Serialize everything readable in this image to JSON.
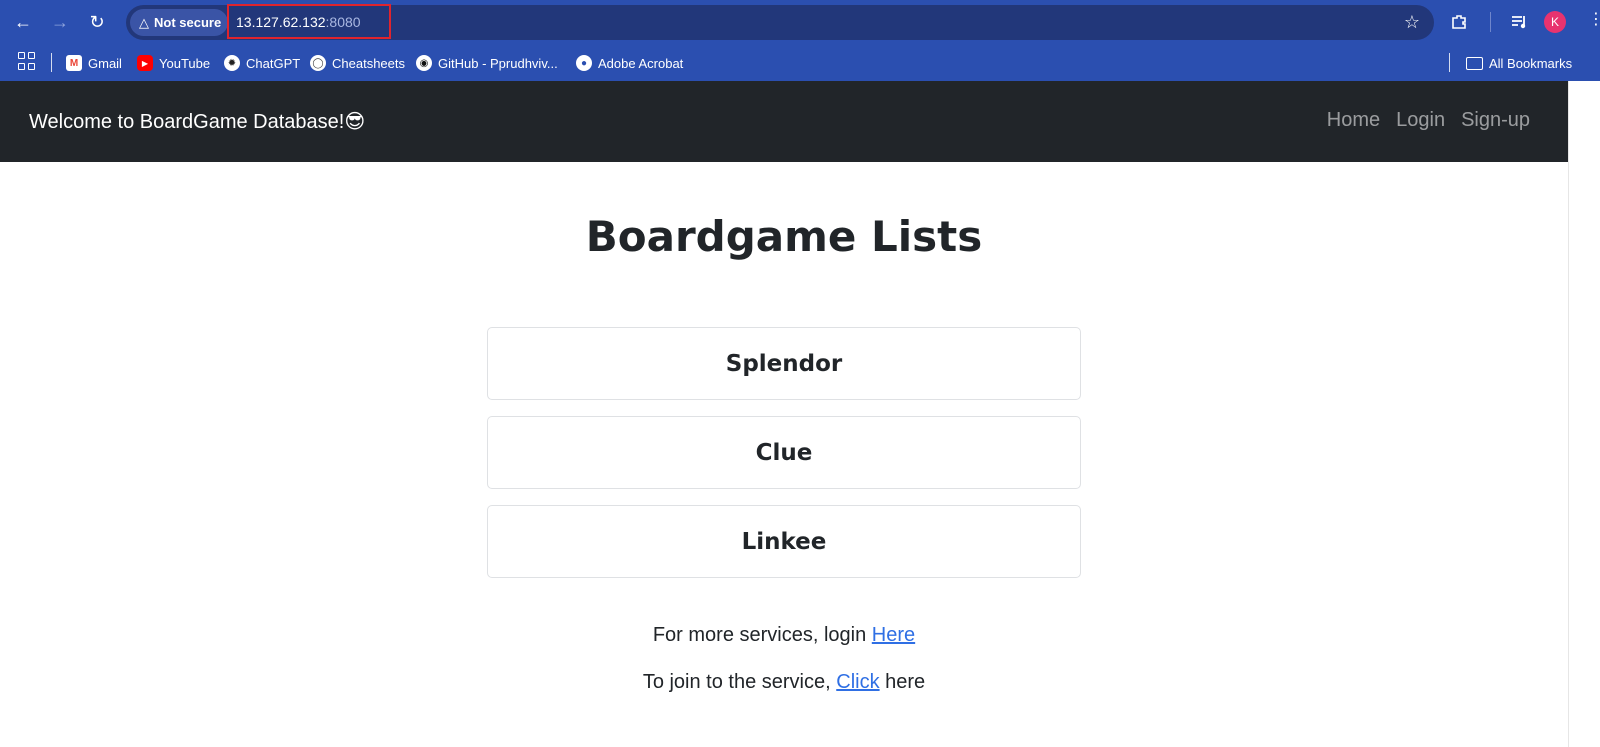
{
  "browser": {
    "security_label": "Not secure",
    "url_host": "13.127.62.132",
    "url_port": ":8080",
    "profile_initial": "K",
    "bookmarks": [
      {
        "label": "Gmail",
        "icon": "gmail-icon"
      },
      {
        "label": "YouTube",
        "icon": "youtube-icon"
      },
      {
        "label": "ChatGPT",
        "icon": "chatgpt-icon"
      },
      {
        "label": "Cheatsheets",
        "icon": "cheatsheets-icon"
      },
      {
        "label": "GitHub - Pprudhviv...",
        "icon": "github-icon"
      },
      {
        "label": "Adobe Acrobat",
        "icon": "adobe-icon"
      }
    ],
    "all_bookmarks_label": "All Bookmarks"
  },
  "navbar": {
    "brand": "Welcome to BoardGame Database!",
    "brand_emoji": "😎",
    "links": [
      "Home",
      "Login",
      "Sign-up"
    ]
  },
  "main": {
    "title": "Boardgame Lists",
    "games": [
      "Splendor",
      "Clue",
      "Linkee"
    ],
    "login_prefix": "For more services, login ",
    "login_link": "Here",
    "join_prefix": "To join to the service, ",
    "join_link": "Click",
    "join_suffix": " here"
  },
  "colors": {
    "browser_chrome": "#2b4fb0",
    "navbar_bg": "#212529",
    "link": "#2f6fe4",
    "url_highlight": "#e0242d"
  }
}
